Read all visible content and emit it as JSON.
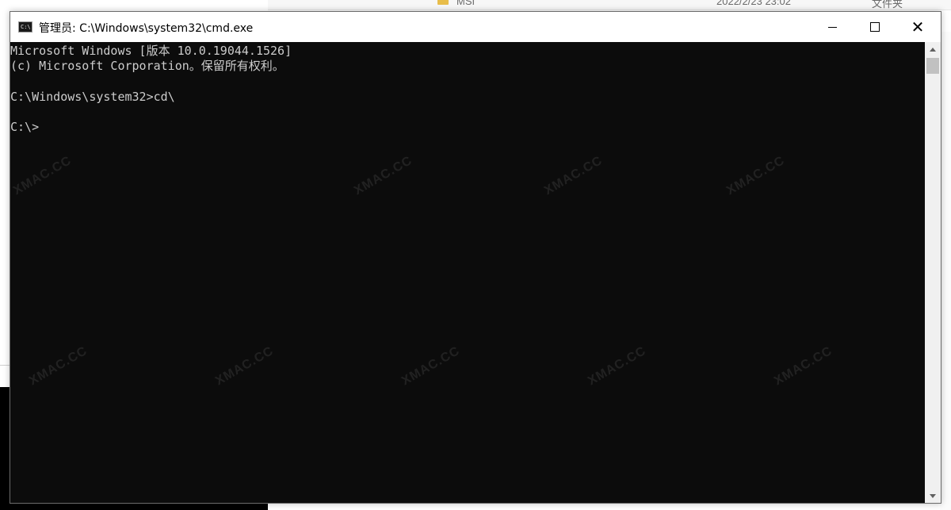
{
  "background_window": {
    "file_row": {
      "name": "MSI",
      "date": "2022/2/23 23:02",
      "type": "文件夹"
    }
  },
  "cmd_window": {
    "title": "管理员: C:\\Windows\\system32\\cmd.exe",
    "icon_text": "C:\\",
    "console_lines": [
      "Microsoft Windows [版本 10.0.19044.1526]",
      "(c) Microsoft Corporation。保留所有权利。",
      "",
      "C:\\Windows\\system32>cd\\",
      "",
      "C:\\>"
    ],
    "buttons": {
      "minimize": "minimize",
      "maximize": "maximize",
      "close": "✕"
    }
  },
  "watermark": "XMAC.CC",
  "colors": {
    "console_bg": "#0c0c0c",
    "console_text": "#cccccc",
    "titlebar_bg": "#ffffff"
  }
}
